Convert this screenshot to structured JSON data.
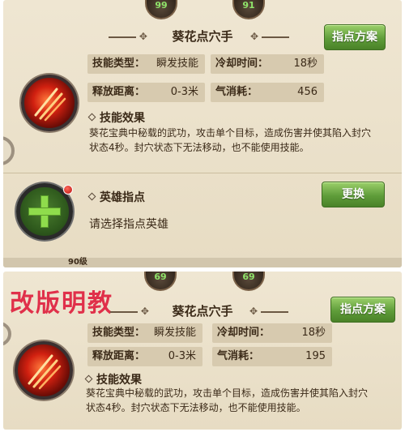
{
  "top_panel": {
    "levels": [
      "99",
      "91"
    ],
    "skill_title": "葵花点穴手",
    "assign_button": "指点方案",
    "stats": [
      {
        "key": "技能类型：",
        "value": "瞬发技能"
      },
      {
        "key": "冷却时间：",
        "value": "18秒"
      },
      {
        "key": "释放距离：",
        "value": "0-3米"
      },
      {
        "key": "气消耗：",
        "value": "456"
      }
    ],
    "effect_heading": "技能效果",
    "effect_desc_line1": "葵花宝典中秘载的武功，攻击单个目标，造成伤害并使其陷入封穴",
    "effect_desc_line2": "状态4秒。封穴状态下无法移动，也不能使用技能。",
    "hero_heading": "英雄指点",
    "hero_prompt": "请选择指点英雄",
    "swap_button": "更换",
    "cut_label": "90级"
  },
  "bottom_panel": {
    "watermark": "改版明教",
    "levels": [
      "69",
      "69"
    ],
    "skill_title": "葵花点穴手",
    "assign_button": "指点方案",
    "stats": [
      {
        "key": "技能类型：",
        "value": "瞬发技能"
      },
      {
        "key": "冷却时间：",
        "value": "18秒"
      },
      {
        "key": "释放距离：",
        "value": "0-3米"
      },
      {
        "key": "气消耗：",
        "value": "195"
      }
    ],
    "effect_heading": "技能效果",
    "effect_desc_line1": "葵花宝典中秘载的武功，攻击单个目标，造成伤害并使其陷入封穴",
    "effect_desc_line2": "状态4秒。封穴状态下无法移动，也不能使用技能。"
  }
}
